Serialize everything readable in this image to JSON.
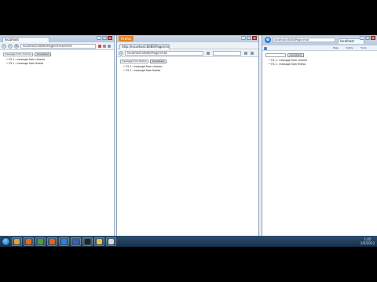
{
  "windows": [
    {
      "tab_title": "localhost",
      "url": "localhost:8080/Pagecheckerent",
      "form": {
        "input_value": "message from chrome",
        "button_label": "broadcast"
      },
      "messages": [
        "Y.5.1 : message from chrome",
        "Y.5.1 : message from firefox"
      ]
    },
    {
      "app_button_label": "Firefox",
      "tab_title": "http://localhost:8080/Page/chat",
      "url": "localhost:8080/Page/chat",
      "form": {
        "input_value": "message from firefox",
        "button_label": "broadcast"
      },
      "messages": [
        "Y.5.1 : message from chrome",
        "Y.5.1 : message from firefox"
      ]
    },
    {
      "url": "localhost:8080/Page/chat",
      "tab_title": "localhost",
      "menu": [
        "Page",
        "Safety",
        "Tools"
      ],
      "form": {
        "input_value": "",
        "button_label": "broadcast"
      },
      "messages": [
        "Y.5.1 : message from chrome",
        "Y.5.1 : message from firefox"
      ]
    }
  ],
  "taskbar": {
    "time": "1:05",
    "date": "2/5/2012",
    "apps": [
      {
        "icon": "explorer-icon",
        "color": "#d8a63a"
      },
      {
        "icon": "media-player-icon",
        "color": "#e46b1a"
      },
      {
        "icon": "chrome-icon",
        "color": "#4c9c3a"
      },
      {
        "icon": "firefox-icon",
        "color": "#e0661c"
      },
      {
        "icon": "ie-icon",
        "color": "#2f7fd3"
      },
      {
        "icon": "app-icon",
        "color": "#3b5fa8"
      },
      {
        "icon": "terminal-icon",
        "color": "#222222"
      },
      {
        "icon": "folder-icon",
        "color": "#e6c24a"
      },
      {
        "icon": "document-icon",
        "color": "#d9d9d9"
      }
    ]
  }
}
